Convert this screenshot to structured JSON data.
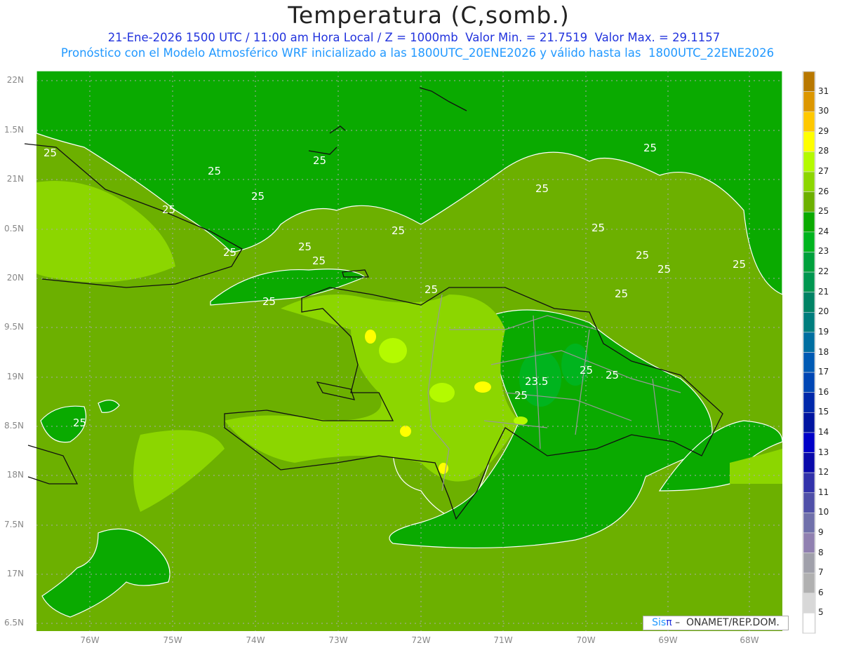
{
  "header": {
    "title": "Temperatura (C,somb.)",
    "line1": "21-Ene-2026 1500 UTC / 11:00 am Hora Local / Z = 1000mb  Valor Min. = 21.7519  Valor Max. = 29.1157",
    "line2": "Pronóstico con el Modelo Atmosférico WRF inicializado a las 1800UTC_20ENE2026 y válido hasta las  1800UTC_22ENE2026"
  },
  "axes": {
    "lat_labels": [
      "22N",
      "1.5N",
      "21N",
      "0.5N",
      "20N",
      "9.5N",
      "19N",
      "8.5N",
      "18N",
      "7.5N",
      "17N",
      "6.5N"
    ],
    "lon_labels": [
      "76W",
      "75W",
      "74W",
      "73W",
      "72W",
      "71W",
      "70W",
      "69W",
      "68W"
    ]
  },
  "colorbar": {
    "labels": [
      "31",
      "30",
      "29",
      "28",
      "27",
      "26",
      "25",
      "24",
      "23",
      "22",
      "21",
      "20",
      "19",
      "18",
      "17",
      "16",
      "15",
      "14",
      "13",
      "12",
      "11",
      "10",
      "9",
      "8",
      "7",
      "6",
      "5"
    ],
    "colors_top_to_bottom": [
      "#b87800",
      "#dc9600",
      "#ffc800",
      "#ffff00",
      "#b4fa00",
      "#8cd600",
      "#6cb000",
      "#0aaa00",
      "#00b41e",
      "#00a03c",
      "#009650",
      "#008264",
      "#007d7d",
      "#006ea0",
      "#005ab4",
      "#0046b4",
      "#0028aa",
      "#0014a0",
      "#0000c8",
      "#0a0aaa",
      "#3232aa",
      "#5050a8",
      "#7070aa",
      "#9080b0",
      "#a0a0aa",
      "#b0b0b0",
      "#d8d8d8",
      "#ffffff"
    ]
  },
  "contour_labels": [
    "25",
    "25",
    "25",
    "25",
    "25",
    "25",
    "25",
    "25",
    "25",
    "25",
    "25",
    "25",
    "25",
    "25",
    "25",
    "25",
    "25",
    "25",
    "25",
    "25",
    "23.5",
    "25",
    "25"
  ],
  "credit": {
    "brand_a": "Sis",
    "brand_b": "π",
    "text": " –  ONAMET/REP.DOM."
  }
}
